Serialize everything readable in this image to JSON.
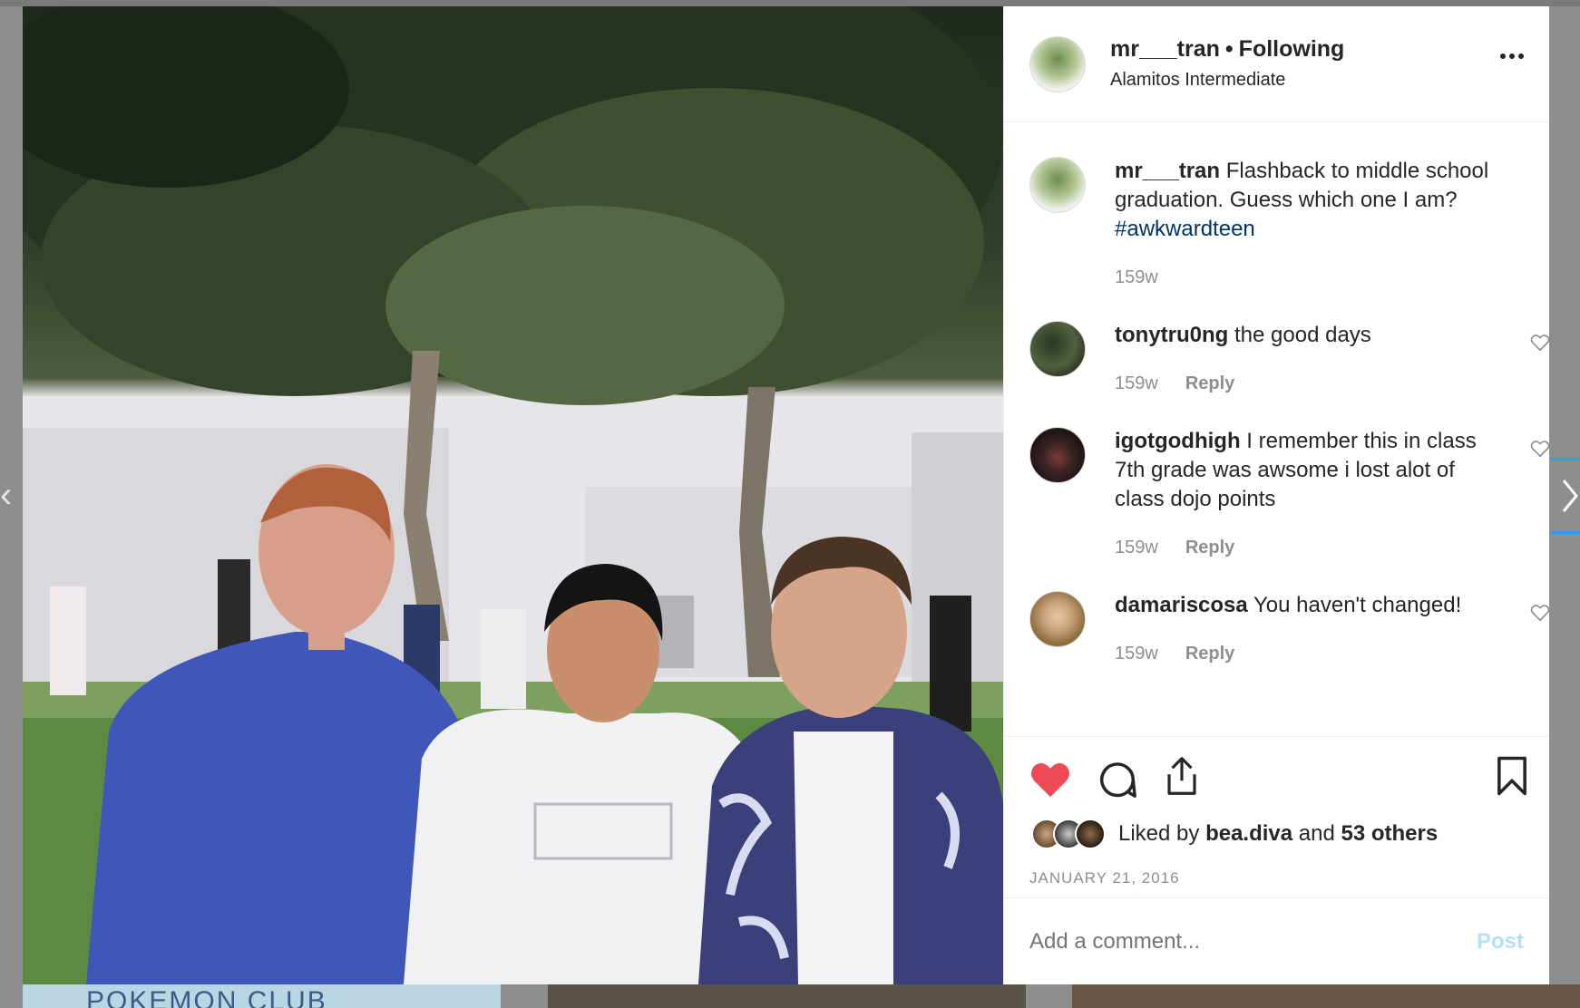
{
  "post": {
    "username": "mr___tran",
    "separator": "•",
    "follow_state": "Following",
    "location": "Alamitos Intermediate",
    "more_icon": "more-horizontal-icon"
  },
  "caption": {
    "username": "mr___tran",
    "text": "Flashback to middle school graduation. Guess which one I am?",
    "hashtag": "#awkwardteen",
    "time": "159w"
  },
  "comments": [
    {
      "username": "tonytru0ng",
      "text": "the good days",
      "time": "159w",
      "reply_label": "Reply"
    },
    {
      "username": "igotgodhigh",
      "text": "I remember this in class 7th grade was awsome i lost alot of class dojo points",
      "time": "159w",
      "reply_label": "Reply"
    },
    {
      "username": "damariscosa",
      "text": "You haven't changed!",
      "time": "159w",
      "reply_label": "Reply"
    }
  ],
  "actions": {
    "like_icon": "heart-filled-icon",
    "comment_icon": "comment-bubble-icon",
    "share_icon": "share-icon",
    "save_icon": "bookmark-icon",
    "like_color": "#ed4956"
  },
  "likes": {
    "prefix": "Liked by",
    "user": "bea.diva",
    "conj": "and",
    "others": "53 others"
  },
  "date": "JANUARY 21, 2016",
  "add_comment": {
    "placeholder": "Add a comment...",
    "post_label": "Post"
  },
  "background": {
    "thumb_text": "POKEMON CLUB"
  }
}
